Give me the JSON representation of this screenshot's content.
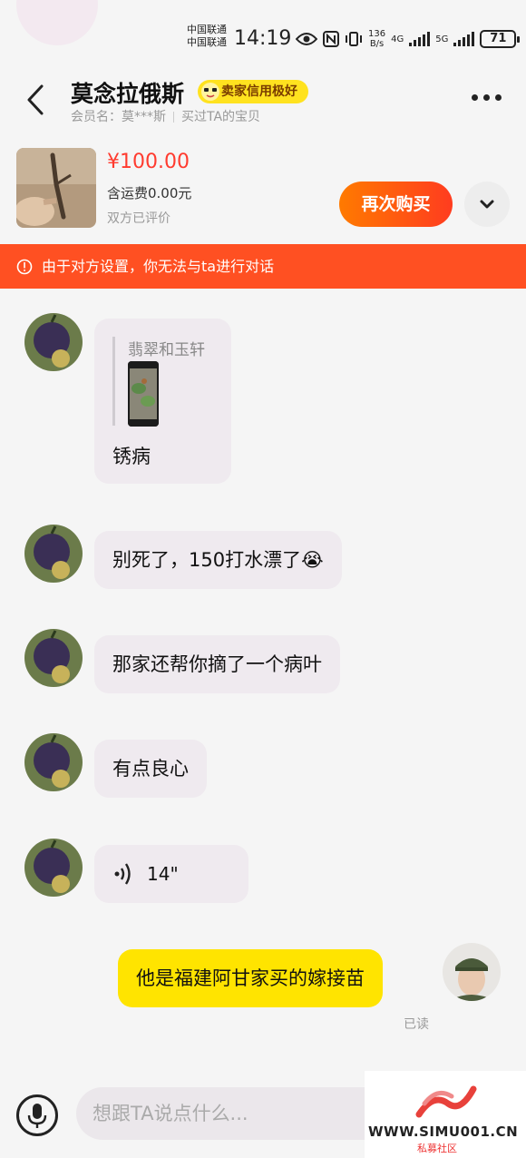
{
  "status_bar": {
    "carrier_1": "中国联通",
    "carrier_2": "中国联通",
    "time": "14:19",
    "net_speed_value": "136",
    "net_speed_unit": "B/s",
    "net_1": "4G",
    "net_2": "5G",
    "battery": "71"
  },
  "header": {
    "seller_name": "莫念拉俄斯",
    "credit_badge": "卖家信用极好",
    "member_label": "会员名：莫***斯",
    "bought_label": "买过TA的宝贝"
  },
  "product": {
    "price": "¥100.00",
    "shipping": "含运费0.00元",
    "review_status": "双方已评价",
    "buy_again": "再次购买"
  },
  "notice": {
    "text": "由于对方设置，你无法与ta进行对话"
  },
  "messages": [
    {
      "sender": "other",
      "type": "quote",
      "quote_name": "翡翠和玉轩",
      "text": "锈病"
    },
    {
      "sender": "other",
      "type": "text",
      "text": "别死了，150打水漂了😭"
    },
    {
      "sender": "other",
      "type": "text",
      "text": "那家还帮你摘了一个病叶"
    },
    {
      "sender": "other",
      "type": "text",
      "text": "有点良心"
    },
    {
      "sender": "other",
      "type": "voice",
      "text": "14\""
    },
    {
      "sender": "me",
      "type": "text",
      "text": "他是福建阿甘家买的嫁接苗",
      "status": "已读"
    }
  ],
  "input": {
    "placeholder": "想跟TA说点什么..."
  },
  "watermark": {
    "site": "WWW.SIMU001.CN",
    "tag": "私募社区"
  },
  "colors": {
    "accent_orange": "#ff5022",
    "price_red": "#ff3b2f",
    "my_bubble": "#ffe400",
    "other_bubble": "#efeaef"
  }
}
